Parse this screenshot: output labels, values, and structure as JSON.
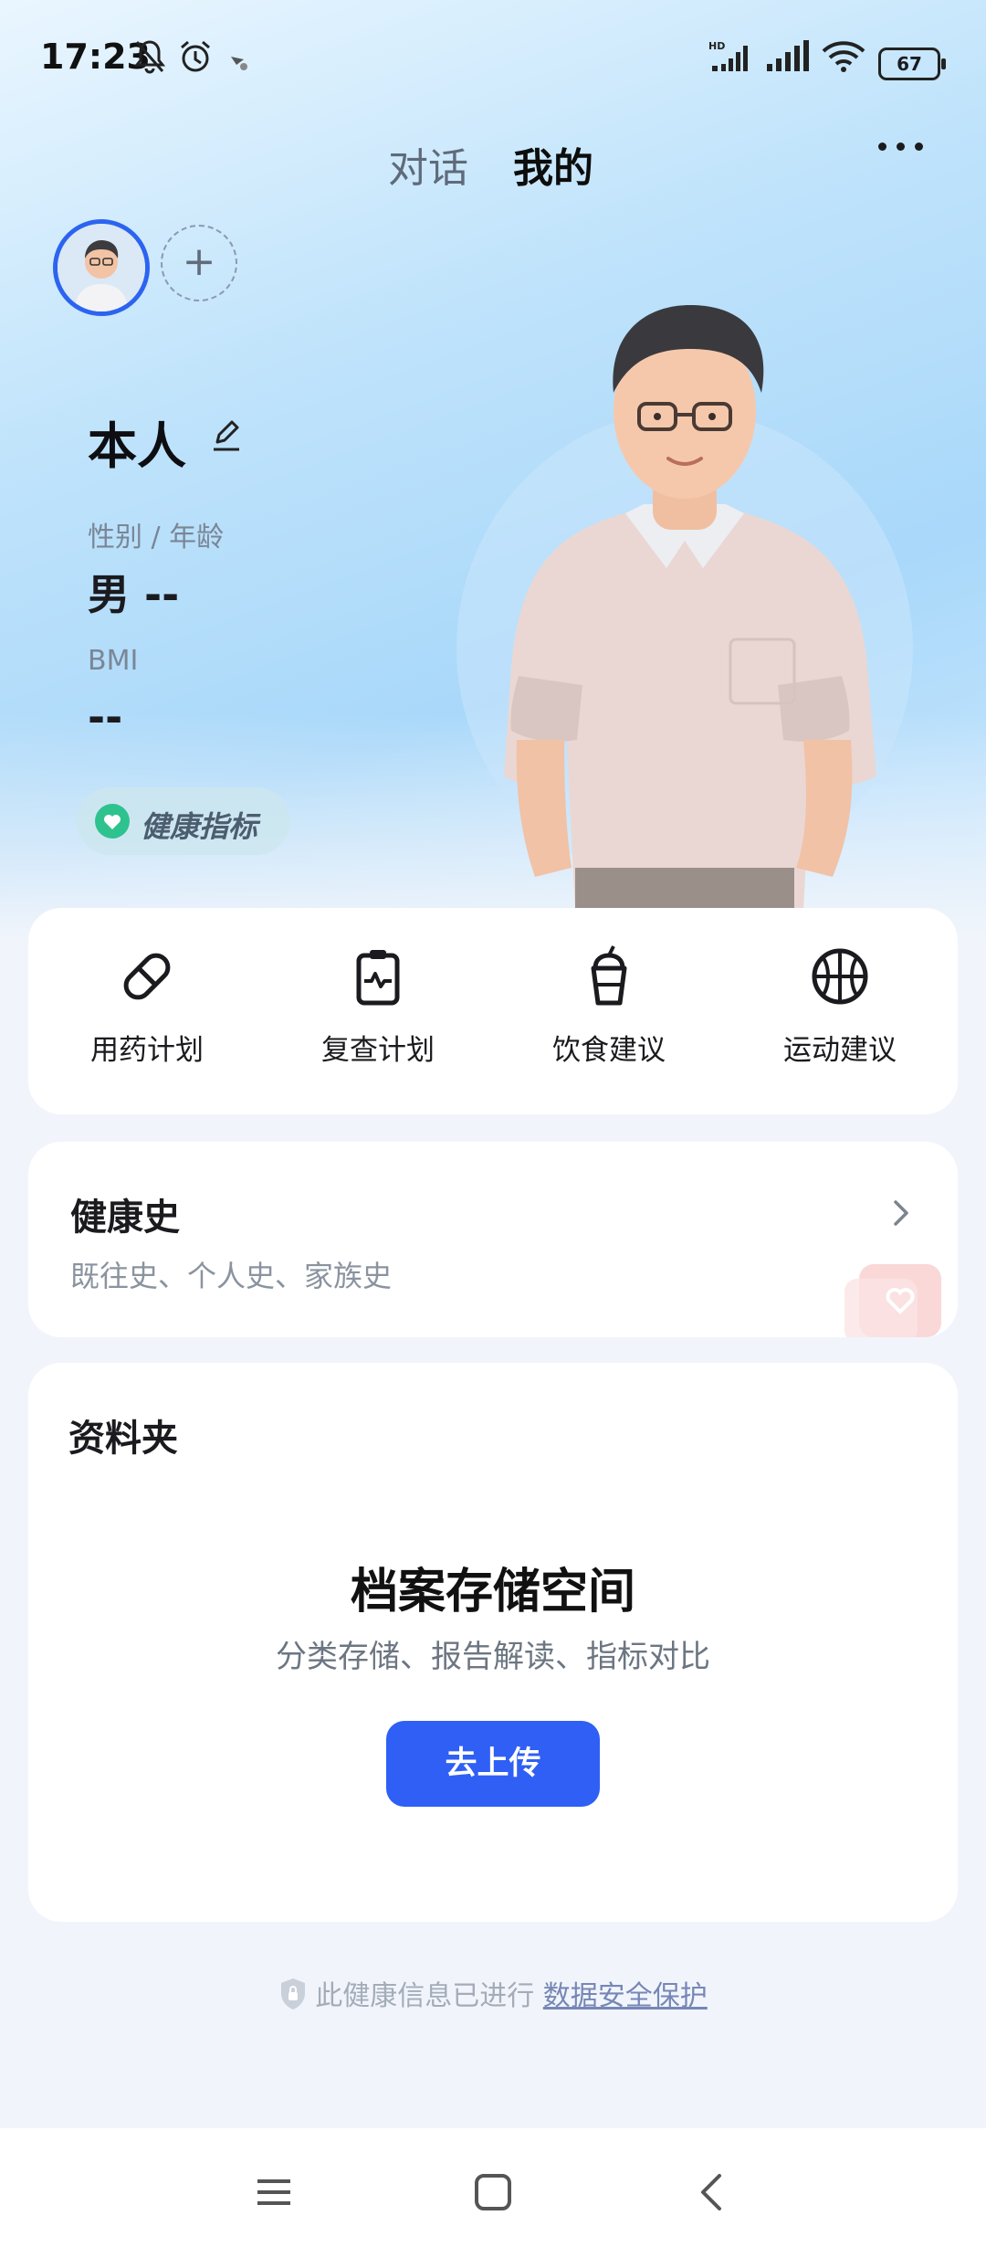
{
  "status_bar": {
    "time": "17:23",
    "battery": "67",
    "icons": [
      "mute-bell-icon",
      "alarm-icon",
      "notification-icon",
      "hd-signal-icon",
      "signal-icon",
      "wifi-icon",
      "battery-icon"
    ]
  },
  "header": {
    "tabs": [
      {
        "label": "对话",
        "active": false
      },
      {
        "label": "我的",
        "active": true
      }
    ],
    "more_icon": "more-horizontal-icon"
  },
  "profile": {
    "add_label": "+",
    "name": "本人",
    "gender_age_label": "性别 / 年龄",
    "gender_age_value": "男  --",
    "bmi_label": "BMI",
    "bmi_value": "--",
    "health_indicator_label": "健康指标"
  },
  "actions": [
    {
      "label": "用药计划",
      "icon": "pill-icon"
    },
    {
      "label": "复查计划",
      "icon": "clipboard-pulse-icon"
    },
    {
      "label": "饮食建议",
      "icon": "drink-cup-icon"
    },
    {
      "label": "运动建议",
      "icon": "basketball-icon"
    }
  ],
  "health_history": {
    "title": "健康史",
    "subtitle": "既往史、个人史、家族史"
  },
  "folder": {
    "title": "资料夹",
    "main_title": "档案存储空间",
    "subtitle": "分类存储、报告解读、指标对比",
    "upload_button": "去上传"
  },
  "footer": {
    "security_text": "此健康信息已进行",
    "security_link": "数据安全保护"
  },
  "colors": {
    "accent": "#2f5ff5",
    "health_green": "#2ec28f"
  }
}
